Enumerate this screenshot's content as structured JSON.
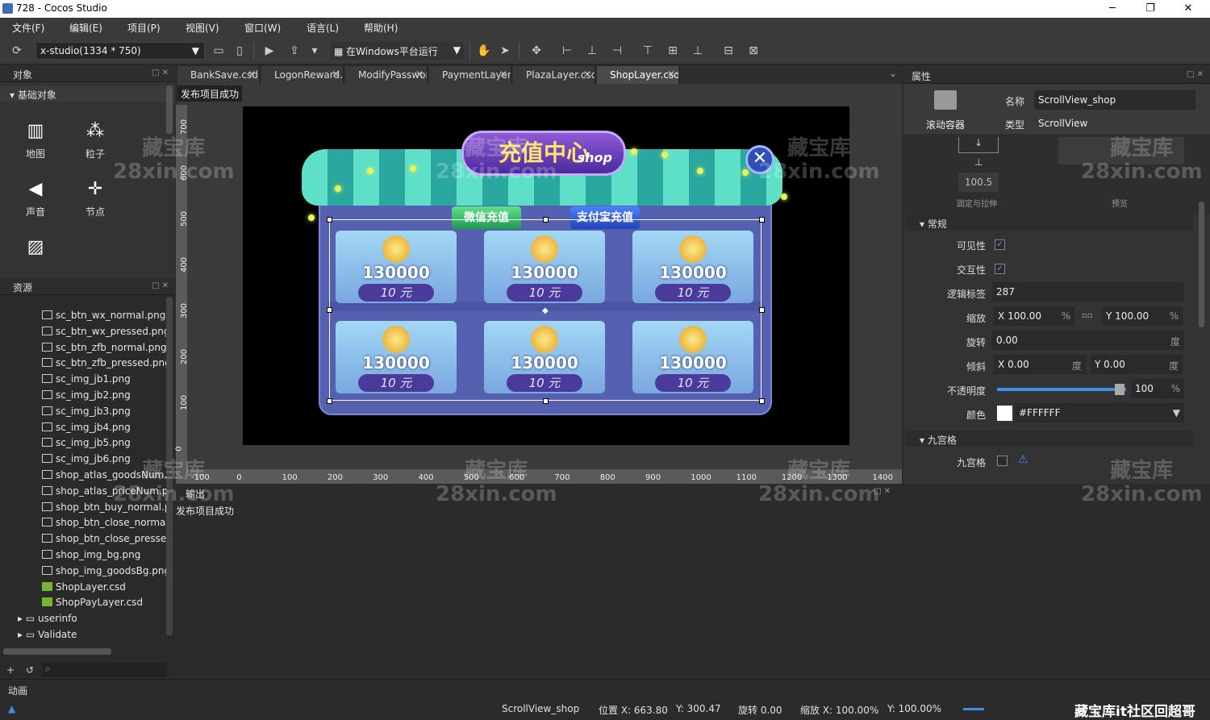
{
  "window": {
    "title": "728 - Cocos Studio",
    "min": "─",
    "max": "❐",
    "close": "✕"
  },
  "menu": [
    "文件(F)",
    "编辑(E)",
    "项目(P)",
    "视图(V)",
    "窗口(W)",
    "语言(L)",
    "帮助(H)"
  ],
  "toolbar": {
    "resolution": "x-studio(1334 * 750)",
    "platform": "在Windows平台运行"
  },
  "objects": {
    "title": "对象",
    "group": "基础对象",
    "items": [
      "地图",
      "粒子",
      "声音",
      "节点"
    ]
  },
  "resources": {
    "title": "资源",
    "files": [
      "sc_btn_wx_normal.png",
      "sc_btn_wx_pressed.png",
      "sc_btn_zfb_normal.png",
      "sc_btn_zfb_pressed.png",
      "sc_img_jb1.png",
      "sc_img_jb2.png",
      "sc_img_jb3.png",
      "sc_img_jb4.png",
      "sc_img_jb5.png",
      "sc_img_jb6.png",
      "shop_atlas_goodsNum.png",
      "shop_atlas_priceNum.png",
      "shop_btn_buy_normal.png",
      "shop_btn_close_normal.png",
      "shop_btn_close_pressed.png",
      "shop_img_bg.png",
      "shop_img_goodsBg.png",
      "ShopLayer.csd",
      "ShopPayLayer.csd"
    ],
    "folders": [
      "userinfo",
      "Validate"
    ]
  },
  "tabs": [
    "BankSave.csd",
    "LogonReward.csd",
    "ModifyPassword.csd",
    "PaymentLayer.csd",
    "PlazaLayer.csd",
    "ShopLayer.csd"
  ],
  "canvas": {
    "publish_msg": "发布项目成功",
    "ruler_v": [
      "700",
      "600",
      "500",
      "400",
      "300",
      "200",
      "100",
      "0"
    ],
    "ruler_h": [
      "-100",
      "0",
      "100",
      "200",
      "300",
      "400",
      "500",
      "600",
      "700",
      "800",
      "900",
      "1000",
      "1100",
      "1200",
      "1300",
      "1400"
    ]
  },
  "game": {
    "title": "充值中心",
    "subtitle": "shop",
    "close": "✕",
    "wechat_btn": "微信充值",
    "alipay_btn": "支付宝充值",
    "goods": [
      {
        "amount": "130000",
        "price": "10 元"
      },
      {
        "amount": "130000",
        "price": "10 元"
      },
      {
        "amount": "130000",
        "price": "10 元"
      },
      {
        "amount": "130000",
        "price": "10 元"
      },
      {
        "amount": "130000",
        "price": "10 元"
      },
      {
        "amount": "130000",
        "price": "10 元"
      }
    ]
  },
  "output": {
    "title": "输出",
    "line": "发布项目成功"
  },
  "properties": {
    "title": "属性",
    "widget_type": "滚动容器",
    "name_label": "名称",
    "name_value": "ScrollView_shop",
    "type_label": "类型",
    "type_value": "ScrollView",
    "anchor_value": "100.5",
    "fixed_label": "固定与拉伸",
    "preview_label": "预览",
    "section_general": "常规",
    "visible_label": "可见性",
    "interactive_label": "交互性",
    "tag_label": "逻辑标签",
    "tag_value": "287",
    "scale_label": "缩放",
    "scale_x": "100.00",
    "scale_y": "100.00",
    "pct": "%",
    "rotation_label": "旋转",
    "rotation_value": "0.00",
    "deg": "度",
    "skew_label": "倾斜",
    "skew_x": "0.00",
    "skew_y": "0.00",
    "opacity_label": "不透明度",
    "opacity_value": "100",
    "opacity_level": 1.0,
    "color_label": "颜色",
    "color_value": "#FFFFFF",
    "section_nine": "九宫格",
    "nine_label": "九宫格",
    "x": "X",
    "y": "Y"
  },
  "bottom": {
    "anim": "动画",
    "node": "ScrollView_shop",
    "pos": "位置 X: 663.80",
    "pos_y": "Y: 300.47",
    "rot": "旋转 0.00",
    "scale": "缩放 X: 100.00%",
    "scale_y": "Y: 100.00%"
  },
  "watermark": {
    "line1": "藏宝库",
    "line2": "28xin.com",
    "footer": "藏宝库it社区回超哥"
  }
}
